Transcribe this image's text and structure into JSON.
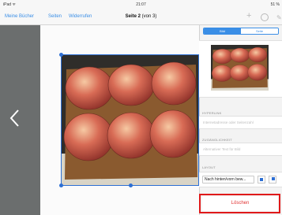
{
  "status_bar": {
    "carrier": "iPad ᯤ",
    "time": "21:07",
    "battery": "51 %"
  },
  "nav": {
    "my_books": "Meine Bücher",
    "pages": "Seiten",
    "undo": "Widerrufen",
    "page_title": "Seite 2",
    "page_count": "(von 3)",
    "icons": [
      "plus-icon",
      "info-icon",
      "wrench-icon"
    ]
  },
  "inspector": {
    "tabs": [
      {
        "label": "Bild",
        "selected": true
      },
      {
        "label": "Seite",
        "selected": false
      }
    ],
    "hyperlink_label": "HYPERLINK",
    "hyperlink_placeholder": "Internetadresse oder Seitenzahl",
    "alt_label": "ZUGÄNGLICHKEIT",
    "alt_placeholder": "Alternativer Text für Bild",
    "layout_label": "LAYOUT",
    "layout_value": "Nach hinten/vorn bew...",
    "delete_label": "Löschen"
  },
  "colors": {
    "accent": "#3a8ee6",
    "selection": "#2d6fd4",
    "delete": "#e03030",
    "highlight": "#e0191a"
  }
}
